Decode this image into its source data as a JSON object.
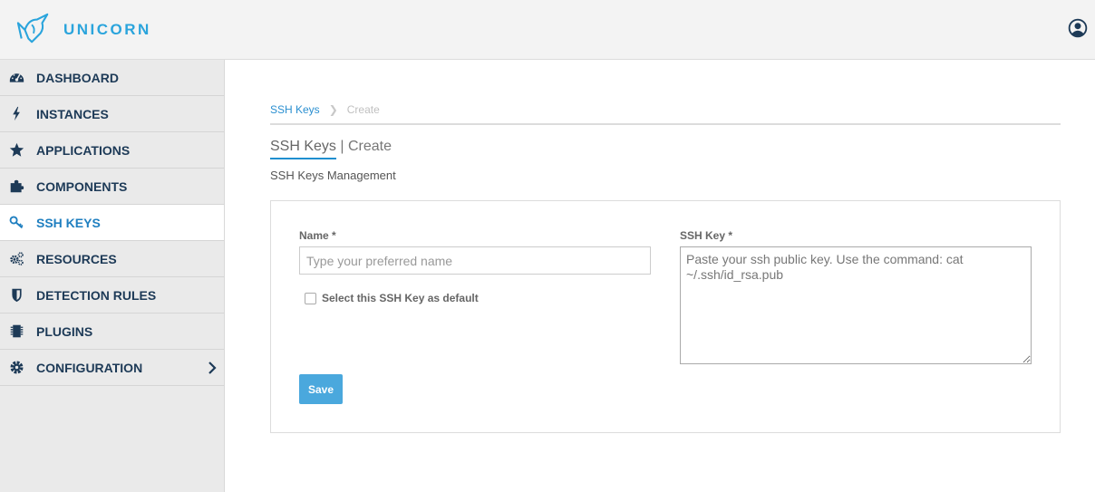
{
  "app": {
    "name": "UNICORN"
  },
  "colors": {
    "brand": "#2aa4dc",
    "nav_text": "#1d3a57",
    "accent": "#1f8fcf",
    "save_button": "#4aa8dd"
  },
  "sidebar": {
    "items": [
      {
        "label": "DASHBOARD",
        "icon": "dashboard-icon"
      },
      {
        "label": "INSTANCES",
        "icon": "bolt-icon"
      },
      {
        "label": "APPLICATIONS",
        "icon": "star-icon"
      },
      {
        "label": "COMPONENTS",
        "icon": "puzzle-icon"
      },
      {
        "label": "SSH KEYS",
        "icon": "key-icon",
        "active": true
      },
      {
        "label": "RESOURCES",
        "icon": "cogs-icon"
      },
      {
        "label": "DETECTION RULES",
        "icon": "shield-icon"
      },
      {
        "label": "PLUGINS",
        "icon": "chip-icon"
      },
      {
        "label": "CONFIGURATION",
        "icon": "gear-icon",
        "has_submenu": true
      }
    ]
  },
  "breadcrumb": {
    "link": "SSH Keys",
    "current": "Create"
  },
  "page": {
    "title_main": "SSH Keys",
    "title_sep": " | ",
    "title_sub": "Create",
    "subtitle": "SSH Keys Management"
  },
  "form": {
    "name_label": "Name *",
    "name_placeholder": "Type your preferred name",
    "name_value": "",
    "default_checkbox_label": "Select this SSH Key as default",
    "default_checked": false,
    "ssh_key_label": "SSH Key *",
    "ssh_key_placeholder": "Paste your ssh public key. Use the command: cat ~/.ssh/id_rsa.pub",
    "ssh_key_value": "",
    "save_label": "Save"
  }
}
